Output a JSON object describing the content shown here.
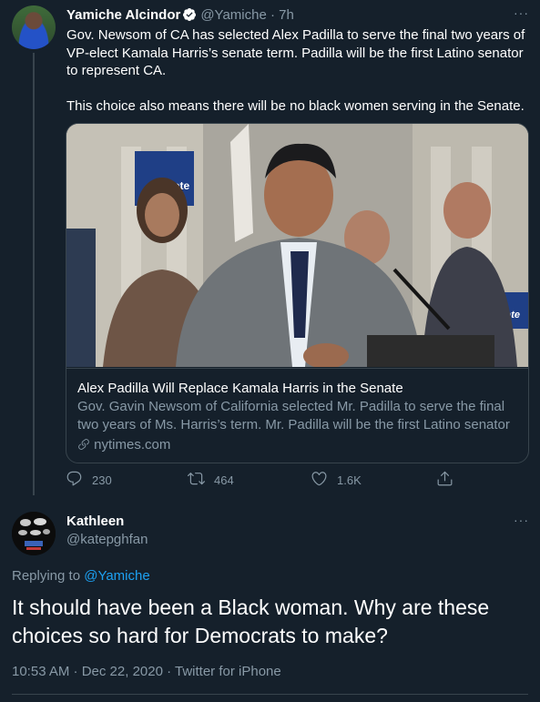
{
  "tweet1": {
    "display_name": "Yamiche Alcindor",
    "handle": "@Yamiche",
    "separator": "·",
    "time": "7h",
    "more": "···",
    "paragraph1": "Gov. Newsom of CA has selected Alex Padilla to serve the final two years of VP-elect Kamala Harris’s senate term. Padilla will be the first Latino senator to represent CA.",
    "paragraph2": "This choice also means there will be no black women serving in the Senate.",
    "card": {
      "title": "Alex Padilla Will Replace Kamala Harris in the Senate",
      "description": "Gov. Gavin Newsom of California selected Mr. Padilla to serve the final two years of Ms. Harris’s term. Mr. Padilla will be the first Latino senator ...",
      "domain": "nytimes.com",
      "image_sign_text_left": "Vote",
      "image_sign_text_right": "TheVote"
    },
    "actions": {
      "replies": "230",
      "retweets": "464",
      "likes": "1.6K"
    }
  },
  "tweet2": {
    "display_name": "Kathleen",
    "handle": "@katepghfan",
    "more": "···",
    "replying_prefix": "Replying to",
    "replying_to": "@Yamiche",
    "text": "It should have been a Black woman. Why are these choices so hard for Democrats to make?",
    "timestamp": "10:53 AM · Dec 22, 2020 · Twitter for iPhone"
  },
  "colors": {
    "background": "#15202b",
    "text": "#ffffff",
    "muted": "#8899a6",
    "link": "#1da1f2",
    "border": "#38444d"
  }
}
